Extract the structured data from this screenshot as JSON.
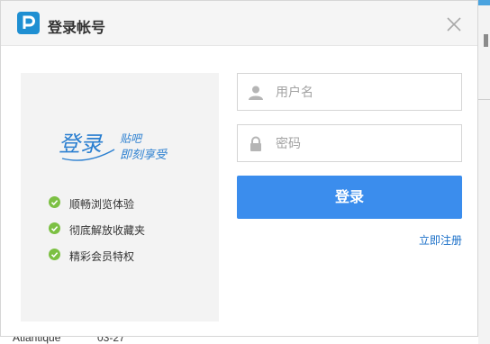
{
  "dialog": {
    "title": "登录帐号",
    "logo_icon": "pinyin-p-logo-icon",
    "close_icon": "close-icon"
  },
  "promo": {
    "art_text_main": "登录",
    "art_text_small_1": "贴吧",
    "art_text_small_2": "即刻享受",
    "features": [
      "顺畅浏览体验",
      "彻底解放收藏夹",
      "精彩会员特权"
    ],
    "check_color": "#7cc043"
  },
  "form": {
    "username_placeholder": "用户名",
    "password_placeholder": "密码",
    "login_label": "登录",
    "register_label": "立即注册",
    "accent": "#3b8ded"
  },
  "background": {
    "bottom_text_1": "Atlantique",
    "bottom_text_2": "03-27"
  }
}
